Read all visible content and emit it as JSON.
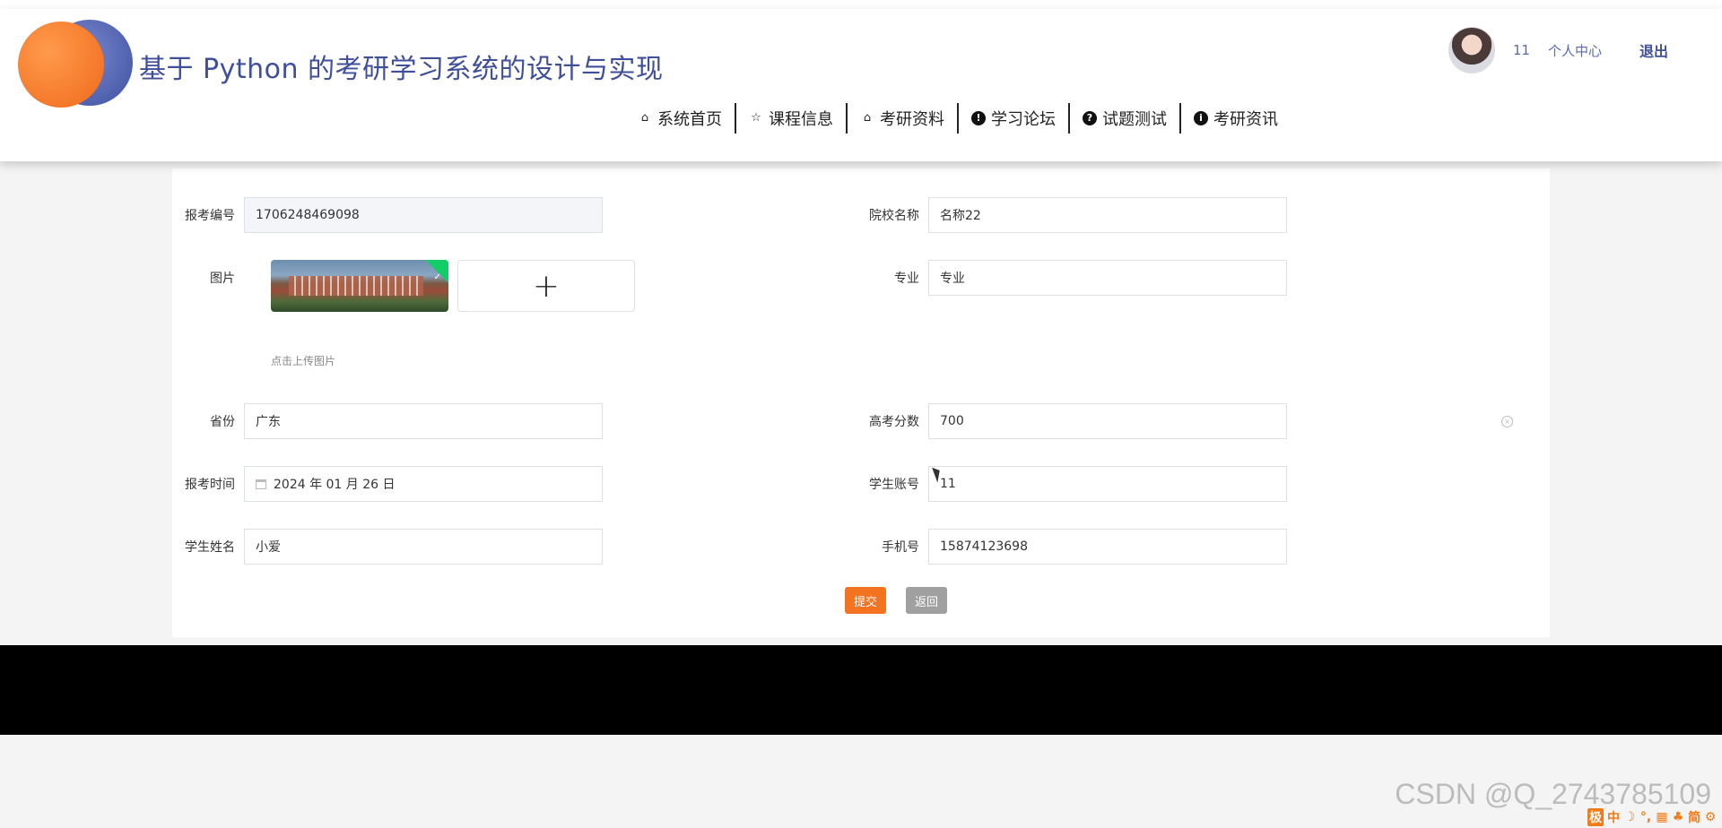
{
  "header": {
    "title": "基于 Python 的考研学习系统的设计与实现",
    "user": {
      "name": "11",
      "center": "个人中心",
      "logout": "退出"
    },
    "nav": [
      {
        "label": "系统首页",
        "icon": "home-icon"
      },
      {
        "label": "课程信息",
        "icon": "star-icon"
      },
      {
        "label": "考研资料",
        "icon": "bag-icon"
      },
      {
        "label": "学习论坛",
        "icon": "exclamation-circle-icon"
      },
      {
        "label": "试题测试",
        "icon": "question-circle-icon"
      },
      {
        "label": "考研资讯",
        "icon": "info-circle-icon"
      }
    ]
  },
  "form": {
    "exam_no": {
      "label": "报考编号",
      "value": "1706248469098"
    },
    "school": {
      "label": "院校名称",
      "value": "名称22"
    },
    "image": {
      "label": "图片",
      "hint": "点击上传图片",
      "add": "+"
    },
    "major": {
      "label": "专业",
      "value": "专业"
    },
    "province": {
      "label": "省份",
      "value": "广东"
    },
    "score": {
      "label": "高考分数",
      "value": "700"
    },
    "date": {
      "label": "报考时间",
      "value": "2024 年 01 月 26 日"
    },
    "account": {
      "label": "学生账号",
      "value": "11"
    },
    "name": {
      "label": "学生姓名",
      "value": "小爱"
    },
    "phone": {
      "label": "手机号",
      "value": "15874123698"
    },
    "submit": "提交",
    "back": "返回"
  },
  "overlay": {
    "watermark": "CSDN @Q_2743785109",
    "ime": [
      "极",
      "中",
      "☽",
      "°,",
      "▦",
      "♣",
      "简",
      "⚙"
    ]
  },
  "colors": {
    "accent": "#f37320",
    "brand": "#3f4f9a",
    "success": "#13ce66"
  }
}
